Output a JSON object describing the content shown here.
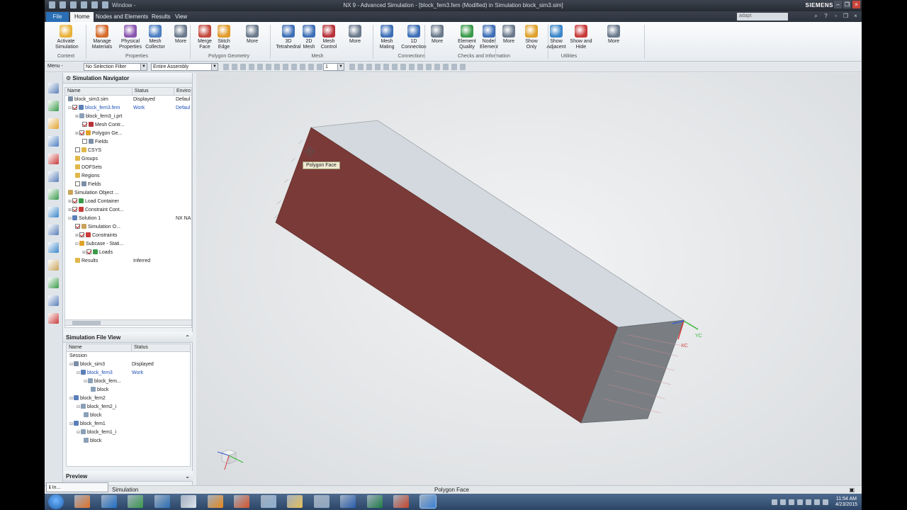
{
  "window": {
    "title": "NX 9 - Advanced Simulation - [block_fem3.fem (Modified) in Simulation block_sim3.sim]",
    "menu_label": "Window -",
    "brand": "SIEMENS",
    "search_placeholder": "adapt"
  },
  "tabs": [
    {
      "label": "File"
    },
    {
      "label": "Home"
    },
    {
      "label": "Nodes and Elements"
    },
    {
      "label": "Results"
    },
    {
      "label": "View"
    }
  ],
  "ribbon": {
    "buttons": [
      {
        "label": "Activate Simulation",
        "icon": "activate-icon",
        "color": "#e8b23a"
      },
      {
        "label": "Manage Materials",
        "icon": "materials-icon",
        "color": "#d46a2b"
      },
      {
        "label": "Physical Properties",
        "icon": "physical-properties-icon",
        "color": "#8a56b0"
      },
      {
        "label": "Mesh Collector",
        "icon": "mesh-collector-icon",
        "color": "#4d7fc1"
      },
      {
        "label": "More",
        "icon": "more-icon",
        "color": "#6b7a8c"
      },
      {
        "label": "Merge Face",
        "icon": "merge-face-icon",
        "color": "#c44a3f"
      },
      {
        "label": "Stitch Edge",
        "icon": "stitch-edge-icon",
        "color": "#e19b2b"
      },
      {
        "label": "More",
        "icon": "more-icon",
        "color": "#6b7a8c"
      },
      {
        "label": "3D Tetrahedral",
        "icon": "tetrahedral-icon",
        "color": "#3e6fb6"
      },
      {
        "label": "2D Mesh",
        "icon": "mesh-2d-icon",
        "color": "#3e6fb6"
      },
      {
        "label": "Mesh Control",
        "icon": "mesh-control-icon",
        "color": "#b8323a"
      },
      {
        "label": "More",
        "icon": "more-icon",
        "color": "#6b7a8c"
      },
      {
        "label": "Mesh Mating",
        "icon": "mesh-mating-icon",
        "color": "#3e6fb6"
      },
      {
        "label": "1D Connection",
        "icon": "connection-icon",
        "color": "#3e6fb6"
      },
      {
        "label": "More",
        "icon": "more-icon",
        "color": "#6b7a8c"
      },
      {
        "label": "Element Quality",
        "icon": "element-quality-icon",
        "color": "#3a9a4a"
      },
      {
        "label": "Node/ Element",
        "icon": "node-element-icon",
        "color": "#3e6fb6"
      },
      {
        "label": "More",
        "icon": "more-icon",
        "color": "#6b7a8c"
      },
      {
        "label": "Show Only",
        "icon": "show-only-icon",
        "color": "#e0a12b"
      },
      {
        "label": "Show Adjacent",
        "icon": "show-adjacent-icon",
        "color": "#3a86c9"
      },
      {
        "label": "Show and Hide",
        "icon": "show-hide-icon",
        "color": "#c93a3a"
      },
      {
        "label": "More",
        "icon": "more-icon",
        "color": "#6b7a8c"
      }
    ],
    "groups": [
      {
        "label": "Context"
      },
      {
        "label": "Properties"
      },
      {
        "label": "Polygon Geometry"
      },
      {
        "label": "Mesh"
      },
      {
        "label": "Connections"
      },
      {
        "label": "Checks and Information"
      },
      {
        "label": "Utilities"
      }
    ]
  },
  "toolbar": {
    "menu": "Menu -",
    "selection_filter": "No Selection Filter",
    "assembly": "Entire Assembly",
    "layer": "1"
  },
  "simulation_navigator": {
    "title": "Simulation Navigator",
    "columns": [
      "Name",
      "Status",
      "Enviro"
    ],
    "rows": [
      {
        "name": "block_sim3.sim",
        "status": "Displayed",
        "env": "Defaul",
        "indent": 0,
        "exp": "",
        "chk": "",
        "icon": "#7a8fa6",
        "work": false
      },
      {
        "name": "block_fem3.fem",
        "status": "Work",
        "env": "Defaul",
        "indent": 0,
        "exp": "−",
        "chk": "on",
        "icon": "#5a7fb8",
        "work": true
      },
      {
        "name": "block_fem3_i.prt",
        "status": "",
        "env": "",
        "indent": 1,
        "exp": "+",
        "chk": "",
        "icon": "#8aa0b8",
        "work": false
      },
      {
        "name": "Mesh Contr...",
        "status": "",
        "env": "",
        "indent": 2,
        "exp": "",
        "chk": "on",
        "icon": "#b8323a",
        "work": false
      },
      {
        "name": "Polygon Ge...",
        "status": "",
        "env": "",
        "indent": 1,
        "exp": "+",
        "chk": "on",
        "icon": "#e0a12b",
        "work": false
      },
      {
        "name": "Fields",
        "status": "",
        "env": "",
        "indent": 2,
        "exp": "",
        "chk": "off",
        "icon": "#7a8fa6",
        "work": false
      },
      {
        "name": "CSYS",
        "status": "",
        "env": "",
        "indent": 1,
        "exp": "",
        "chk": "off",
        "icon": "#e0b84a",
        "work": false
      },
      {
        "name": "Groups",
        "status": "",
        "env": "",
        "indent": 1,
        "exp": "",
        "chk": "",
        "icon": "#e0b84a",
        "work": false
      },
      {
        "name": "DOFSets",
        "status": "",
        "env": "",
        "indent": 1,
        "exp": "",
        "chk": "",
        "icon": "#e0b84a",
        "work": false
      },
      {
        "name": "Regions",
        "status": "",
        "env": "",
        "indent": 1,
        "exp": "",
        "chk": "",
        "icon": "#e0b84a",
        "work": false
      },
      {
        "name": "Fields",
        "status": "",
        "env": "",
        "indent": 1,
        "exp": "",
        "chk": "off",
        "icon": "#7a8fa6",
        "work": false
      },
      {
        "name": "Simulation Object ...",
        "status": "",
        "env": "",
        "indent": 0,
        "exp": "",
        "chk": "",
        "icon": "#c9a35a",
        "work": false
      },
      {
        "name": "Load Container",
        "status": "",
        "env": "",
        "indent": 0,
        "exp": "+",
        "chk": "on",
        "icon": "#3a9a4a",
        "work": false
      },
      {
        "name": "Constraint Cont...",
        "status": "",
        "env": "",
        "indent": 0,
        "exp": "+",
        "chk": "on",
        "icon": "#c93a3a",
        "work": false
      },
      {
        "name": "Solution 1",
        "status": "",
        "env": "NX NA",
        "indent": 0,
        "exp": "−",
        "chk": "",
        "icon": "#5a7fb8",
        "work": false
      },
      {
        "name": "Simulation O...",
        "status": "",
        "env": "",
        "indent": 1,
        "exp": "",
        "chk": "on",
        "icon": "#c9a35a",
        "work": false
      },
      {
        "name": "Constraints",
        "status": "",
        "env": "",
        "indent": 1,
        "exp": "+",
        "chk": "on",
        "icon": "#c93a3a",
        "work": false
      },
      {
        "name": "Subcase - Stati...",
        "status": "",
        "env": "",
        "indent": 1,
        "exp": "−",
        "chk": "",
        "icon": "#e0a12b",
        "work": false
      },
      {
        "name": "Loads",
        "status": "",
        "env": "",
        "indent": 2,
        "exp": "+",
        "chk": "on",
        "icon": "#3a9a4a",
        "work": false
      },
      {
        "name": "Results",
        "status": "Inferred",
        "env": "",
        "indent": 1,
        "exp": "",
        "chk": "",
        "icon": "#e0b84a",
        "work": false
      }
    ]
  },
  "simulation_file_view": {
    "title": "Simulation File View",
    "columns": [
      "Name",
      "Status"
    ],
    "rows": [
      {
        "name": "Session",
        "status": "",
        "indent": 0,
        "exp": "",
        "icon": "",
        "work": false
      },
      {
        "name": "block_sim3",
        "status": "Displayed",
        "indent": 0,
        "exp": "−",
        "icon": "#7a8fa6",
        "work": false
      },
      {
        "name": "block_fem3",
        "status": "Work",
        "indent": 1,
        "exp": "−",
        "icon": "#5a7fb8",
        "work": true
      },
      {
        "name": "block_fem...",
        "status": "",
        "indent": 2,
        "exp": "−",
        "icon": "#8aa0b8",
        "work": false
      },
      {
        "name": "block",
        "status": "",
        "indent": 3,
        "exp": "",
        "icon": "#8aa0b8",
        "work": false
      },
      {
        "name": "block_fem2",
        "status": "",
        "indent": 0,
        "exp": "−",
        "icon": "#5a7fb8",
        "work": false
      },
      {
        "name": "block_fem2_i",
        "status": "",
        "indent": 1,
        "exp": "−",
        "icon": "#8aa0b8",
        "work": false
      },
      {
        "name": "block",
        "status": "",
        "indent": 2,
        "exp": "",
        "icon": "#8aa0b8",
        "work": false
      },
      {
        "name": "block_fem1",
        "status": "",
        "indent": 0,
        "exp": "−",
        "icon": "#5a7fb8",
        "work": false
      },
      {
        "name": "block_fem1_i",
        "status": "",
        "indent": 1,
        "exp": "−",
        "icon": "#8aa0b8",
        "work": false
      },
      {
        "name": "block",
        "status": "",
        "indent": 2,
        "exp": "",
        "icon": "#8aa0b8",
        "work": false
      }
    ]
  },
  "preview": {
    "title": "Preview"
  },
  "viewport": {
    "tooltip": "Polygon Face",
    "axis_labels": {
      "yc": "YC",
      "xc": "XC"
    },
    "colors": {
      "top_face": "#d3d9de",
      "front_face": "#7a3a37",
      "end_face": "#7a7e83",
      "background": "#e4e6e8"
    }
  },
  "status_bar": {
    "left": "Simulation",
    "center": "Polygon Face",
    "minimized_panel": "In..."
  },
  "taskbar": {
    "apps": [
      "start",
      "firefox",
      "outlook",
      "qlik",
      "app-blue",
      "writer",
      "butterfly",
      "matlab",
      "network",
      "folder",
      "notepad",
      "word",
      "excel",
      "powerpoint",
      "nx"
    ],
    "clock_time": "11:54 AM",
    "clock_date": "4/23/2015"
  }
}
